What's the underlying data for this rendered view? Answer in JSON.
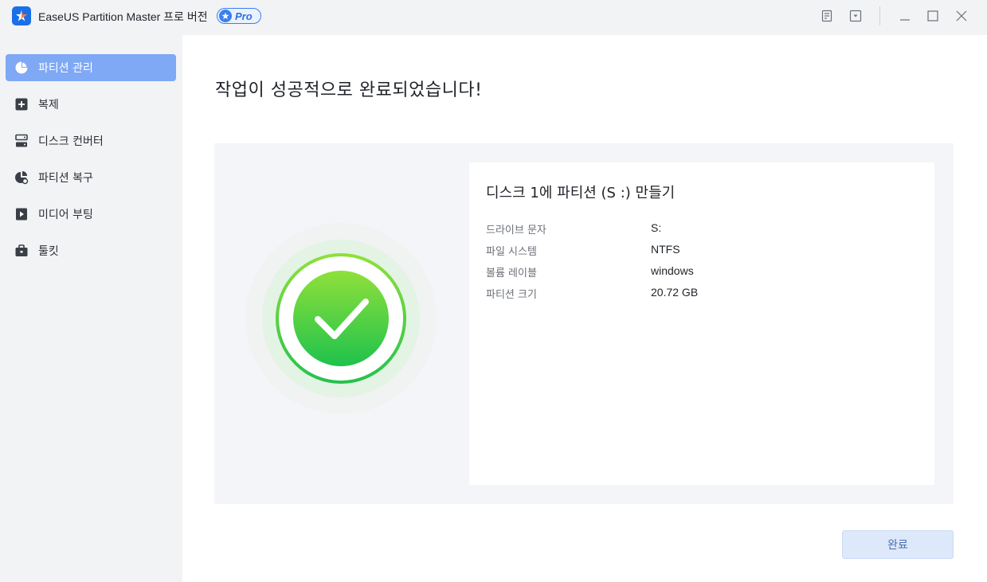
{
  "app": {
    "title": "EaseUS Partition Master 프로 버전",
    "badge": "Pro"
  },
  "sidebar": {
    "items": [
      {
        "label": "파티션 관리",
        "icon": "pie-chart-icon",
        "active": true
      },
      {
        "label": "복제",
        "icon": "clone-icon",
        "active": false
      },
      {
        "label": "디스크 컨버터",
        "icon": "disk-converter-icon",
        "active": false
      },
      {
        "label": "파티션 복구",
        "icon": "partition-recovery-icon",
        "active": false
      },
      {
        "label": "미디어 부팅",
        "icon": "media-boot-icon",
        "active": false
      },
      {
        "label": "툴킷",
        "icon": "toolkit-icon",
        "active": false
      }
    ]
  },
  "main": {
    "heading": "작업이 성공적으로 완료되었습니다!",
    "card": {
      "title": "디스크 1에 파티션 (S :) 만들기",
      "rows": [
        {
          "key": "드라이브 문자",
          "value": "S:"
        },
        {
          "key": "파일 시스템",
          "value": "NTFS"
        },
        {
          "key": "볼륨 레이블",
          "value": "windows"
        },
        {
          "key": "파티션 크기",
          "value": "20.72 GB"
        }
      ]
    },
    "done_label": "완료"
  },
  "colors": {
    "accent": "#7fa8f5",
    "success": "#2fbf4a",
    "brand": "#1a6fe8"
  }
}
